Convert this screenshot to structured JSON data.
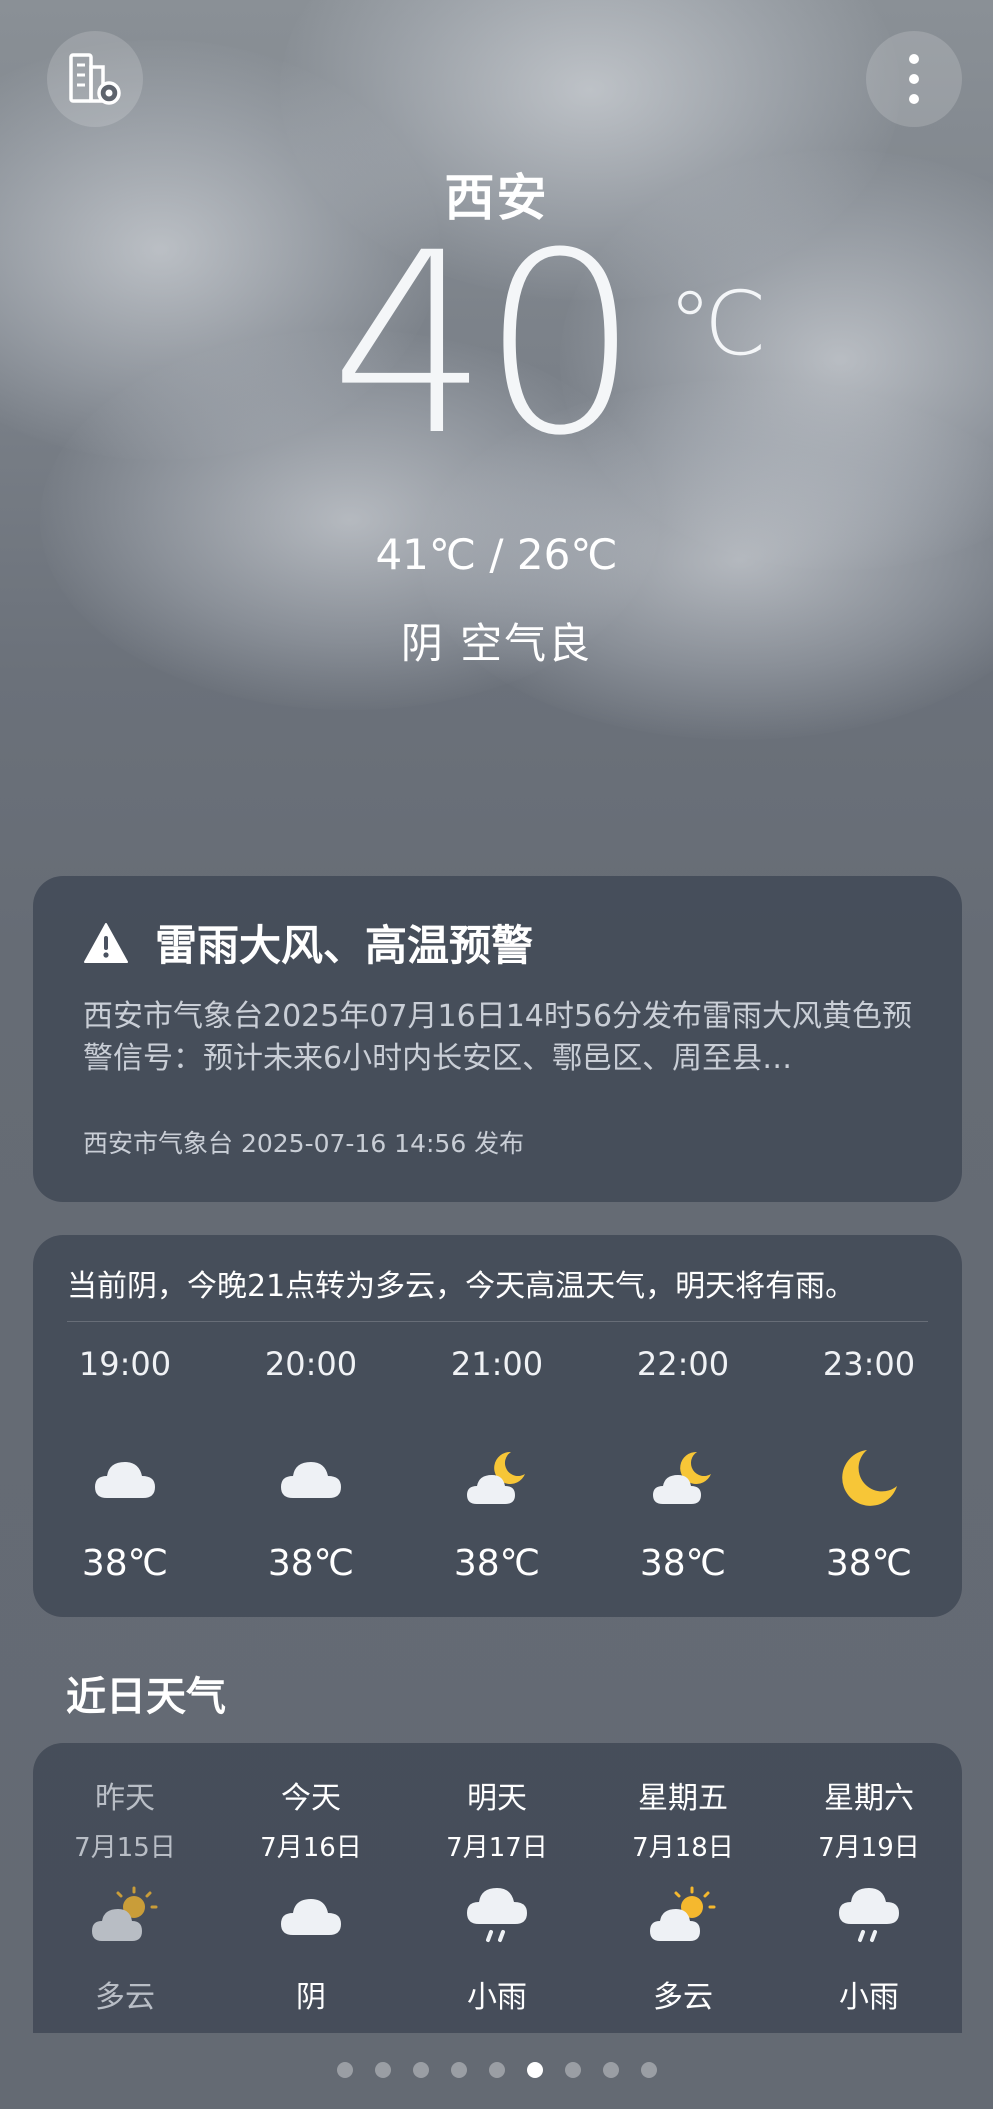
{
  "header": {
    "city": "西安",
    "temperature": "40",
    "unit": "℃",
    "hi_lo": "41℃ / 26℃",
    "condition": "阴  空气良"
  },
  "alert": {
    "title": "雷雨大风、高温预警",
    "body": "西安市气象台2025年07月16日14时56分发布雷雨大风黄色预警信号：预计未来6小时内长安区、鄠邑区、周至县…",
    "source": "西安市气象台 2025-07-16 14:56 发布"
  },
  "hourly": {
    "summary": "当前阴，今晚21点转为多云，今天高温天气，明天将有雨。",
    "items": [
      {
        "time": "19:00",
        "icon": "cloudy-icon",
        "temp": "38℃"
      },
      {
        "time": "20:00",
        "icon": "cloudy-icon",
        "temp": "38℃"
      },
      {
        "time": "21:00",
        "icon": "partly-cloudy-night-icon",
        "temp": "38℃"
      },
      {
        "time": "22:00",
        "icon": "partly-cloudy-night-icon",
        "temp": "38℃"
      },
      {
        "time": "23:00",
        "icon": "moon-icon",
        "temp": "38℃"
      }
    ]
  },
  "daily": {
    "title": "近日天气",
    "items": [
      {
        "day": "昨天",
        "date": "7月15日",
        "icon": "partly-cloudy-icon",
        "condition": "多云"
      },
      {
        "day": "今天",
        "date": "7月16日",
        "icon": "cloudy-icon",
        "condition": "阴"
      },
      {
        "day": "明天",
        "date": "7月17日",
        "icon": "light-rain-icon",
        "condition": "小雨"
      },
      {
        "day": "星期五",
        "date": "7月18日",
        "icon": "partly-cloudy-icon",
        "condition": "多云"
      },
      {
        "day": "星期六",
        "date": "7月19日",
        "icon": "light-rain-icon",
        "condition": "小雨"
      }
    ]
  },
  "pager": {
    "count": 9,
    "active_index": 5
  },
  "colors": {
    "moon": "#f7c637",
    "sun": "#f5b82e",
    "cloud": "#eef1f5",
    "card": "#3a4250"
  }
}
